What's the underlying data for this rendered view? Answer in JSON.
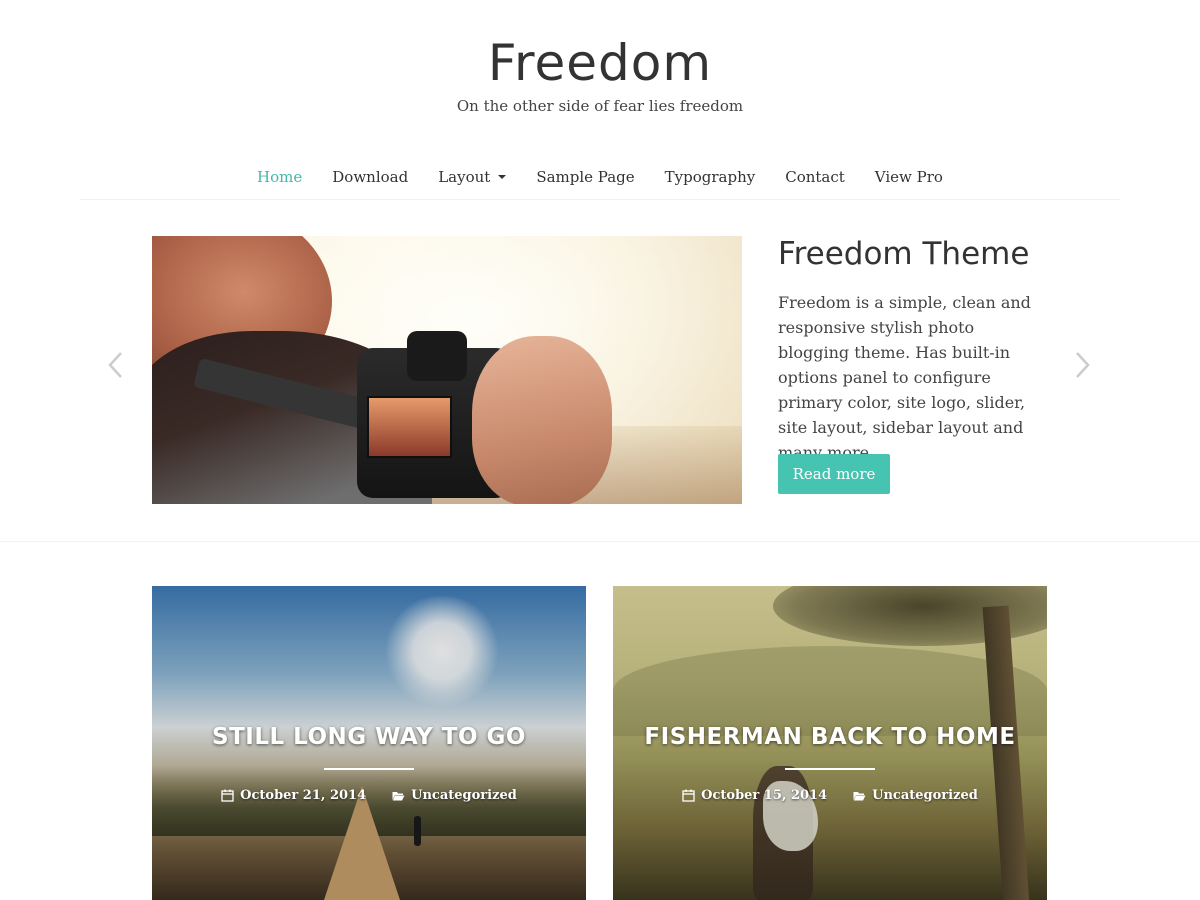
{
  "site": {
    "title": "Freedom",
    "tagline": "On the other side of fear lies freedom"
  },
  "nav": {
    "items": [
      {
        "label": "Home",
        "active": true
      },
      {
        "label": "Download"
      },
      {
        "label": "Layout",
        "has_dropdown": true
      },
      {
        "label": "Sample Page"
      },
      {
        "label": "Typography"
      },
      {
        "label": "Contact"
      },
      {
        "label": "View Pro"
      }
    ]
  },
  "slider": {
    "title": "Freedom Theme",
    "description": "Freedom is a simple, clean and responsive stylish photo blogging theme. Has built-in options panel to configure primary color, site logo, slider, site layout, sidebar layout and many more.",
    "button_label": "Read more",
    "prev_icon": "chevron-left-icon",
    "next_icon": "chevron-right-icon"
  },
  "posts": [
    {
      "title": "STILL LONG WAY TO GO",
      "date": "October 21, 2014",
      "category": "Uncategorized"
    },
    {
      "title": "FISHERMAN BACK TO HOME",
      "date": "October 15, 2014",
      "category": "Uncategorized"
    }
  ],
  "colors": {
    "accent": "#47c3b1",
    "nav_active": "#43b9a8",
    "text": "#333333"
  }
}
